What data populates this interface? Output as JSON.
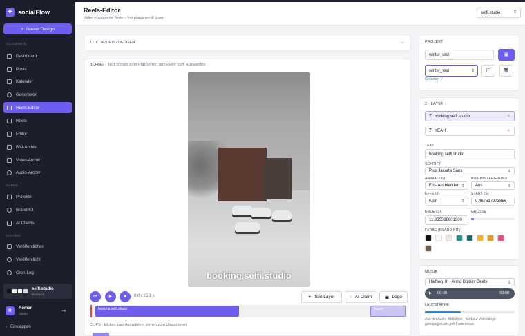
{
  "app": {
    "name": "socialFlow",
    "new_design": "Neues Design"
  },
  "sidebar": {
    "sections": {
      "general": "ALLGEMEIN",
      "brand": "MARKE",
      "system": "SYSTEM"
    },
    "items": [
      {
        "label": "Dashboard"
      },
      {
        "label": "Posts"
      },
      {
        "label": "Kalender"
      },
      {
        "label": "Generieren"
      },
      {
        "label": "Reels-Editor"
      },
      {
        "label": "Reels"
      },
      {
        "label": "Editor"
      },
      {
        "label": "Bild-Archiv"
      },
      {
        "label": "Video-Archiv"
      },
      {
        "label": "Audio-Archiv"
      },
      {
        "label": "Projekte"
      },
      {
        "label": "Brand Kit"
      },
      {
        "label": "AI Claims"
      },
      {
        "label": "Veröffentlichen"
      },
      {
        "label": "Veröffentlicht"
      },
      {
        "label": "Cron-Log"
      }
    ],
    "workspace": {
      "name": "selfi.studio",
      "sub": "Brand Kit"
    },
    "user": {
      "initial": "R",
      "name": "Roman",
      "role": "Admin"
    },
    "collapse": "Einklappen"
  },
  "header": {
    "title": "Reels-Editor",
    "subtitle": "Video + animierte Texte – frei platzieren & timen",
    "workspace_select": "selfi.studio"
  },
  "clips_section": {
    "title": "1 · CLIPS HINZUFÜGEN"
  },
  "stage": {
    "title": "BÜHNE",
    "note": "· Text ziehen zum Platzieren, anklicken zum Auswählen",
    "overlay_text": "booking.selfi.studio",
    "time": "0.0 / 25.1 s",
    "buttons": {
      "text_layer": "Text-Layer",
      "ai_claim": "AI Claim",
      "logo": "Logo"
    },
    "timeline": {
      "seg1": "booking.selfi.studio",
      "seg2": "YEAH"
    },
    "clips_note": "CLIPS · klicken zum Auswählen, ziehen zum Umsortieren"
  },
  "project": {
    "title": "PROJEKT",
    "name_value": "winter_test",
    "select_value": "winter_test",
    "status": "Geladen ✓"
  },
  "layers": {
    "title": "2 · LAYER",
    "items": [
      {
        "label": "booking.selfi.studio"
      },
      {
        "label": "YEAH"
      }
    ],
    "text_label": "TEXT",
    "text_value": "booking.selfi.studio",
    "font_label": "SCHRIFT",
    "font_value": "Plus Jakarta Sans",
    "animation_label": "ANIMATION",
    "animation_value": "Ein-/Ausblenden",
    "box_label": "BOX-HINTERGRUND",
    "box_value": "Aus",
    "effect_label": "EFFEKT",
    "effect_value": "Kein",
    "start_label": "START (S)",
    "start_value": "0.467517973856",
    "end_label": "ENDE (S)",
    "end_value": "11.835586601300",
    "size_label": "GRÖSSE",
    "size_value": 0.07,
    "colors_label": "FARBE (BRAND KIT)",
    "colors": [
      "#111111",
      "#f7f3ee",
      "#efe6da",
      "#2a8a8c",
      "#1f6b6e",
      "#f2b731",
      "#e8a117",
      "#e94f7a",
      "#6b5e53"
    ]
  },
  "music": {
    "title": "MUSIK",
    "track": "Halfway In - Anno Domini Beats",
    "time_start": "00:00",
    "time_end": "00:00",
    "volume_label": "LAUTSTÄRKE",
    "volume_value": 0.4,
    "note": "Aus der Audio-Bibliothek · wird auf Videolänge geloopt/gekürzt, mit Fade in/out."
  },
  "colors": {
    "accent": "#6d5df0",
    "sidebar": "#1c1f2b"
  }
}
